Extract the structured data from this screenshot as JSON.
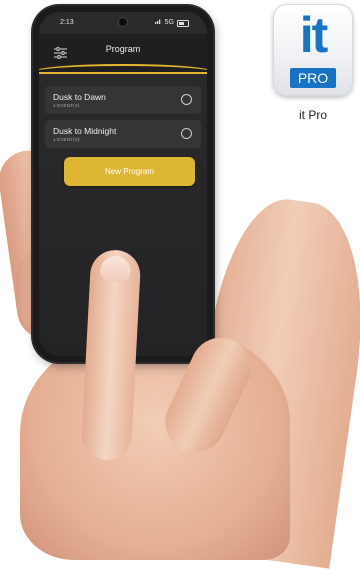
{
  "status_bar": {
    "time": "2:13",
    "network": "5G"
  },
  "header": {
    "title": "Program",
    "filter_icon": "sliders-icon"
  },
  "programs": [
    {
      "name": "Dusk to Dawn",
      "events": "1 EVENT(S)",
      "selected": false
    },
    {
      "name": "Dusk to Midnight",
      "events": "1 EVENT(S)",
      "selected": false
    }
  ],
  "new_program_button": "New Program",
  "app_tile": {
    "it": "it",
    "pro": "PRO",
    "caption": "it Pro",
    "brand_color": "#1673c5"
  },
  "accent_color": "#ddb634"
}
